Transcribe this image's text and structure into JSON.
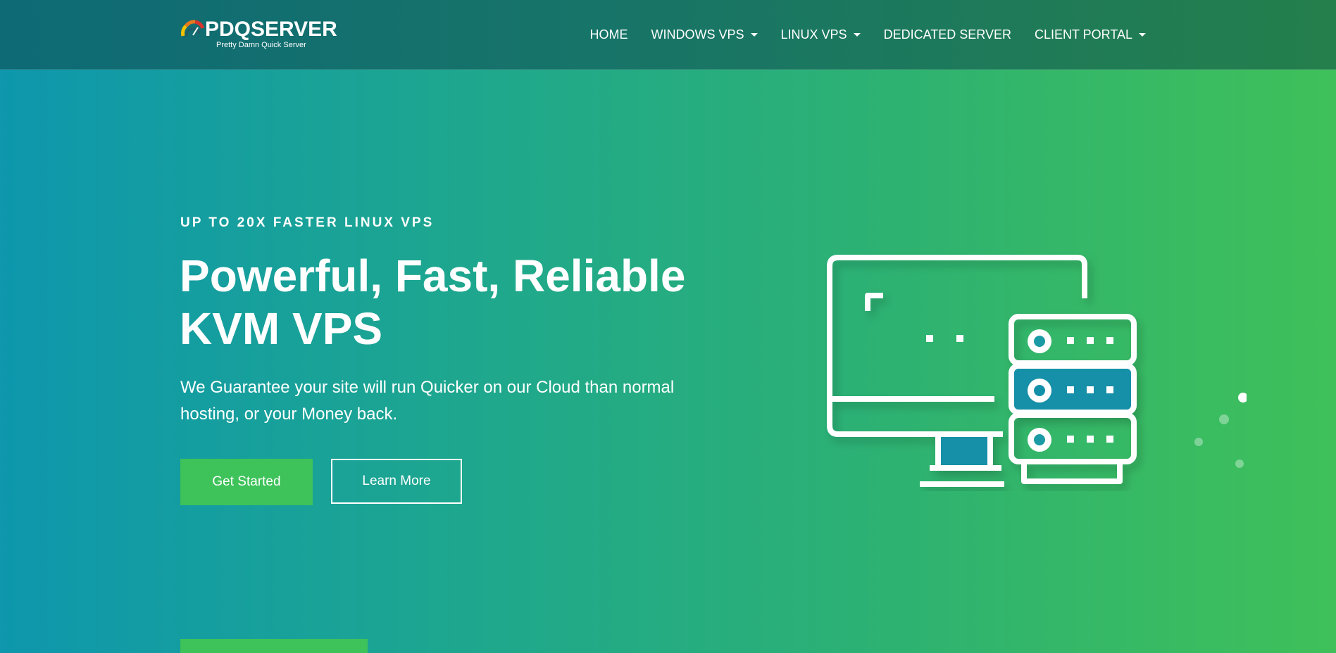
{
  "brand": {
    "name": "PDQSERVER",
    "tagline": "Pretty Damn Quick Server"
  },
  "nav": {
    "home": "HOME",
    "windows_vps": "WINDOWS VPS",
    "linux_vps": "LINUX VPS",
    "dedicated_server": "DEDICATED SERVER",
    "client_portal": "CLIENT PORTAL"
  },
  "hero": {
    "kicker": "UP TO 20X FASTER LINUX VPS",
    "title_line1": "Powerful, Fast, Reliable",
    "title_line2": "KVM VPS",
    "subtitle": "We Guarantee your site will run Quicker on our Cloud than normal hosting, or your Money back.",
    "primary_button": "Get Started",
    "secondary_button": "Learn More"
  },
  "icons": {
    "logo": "speedometer-logo-icon",
    "illustration": "monitor-server-icon",
    "caret": "chevron-down-icon"
  },
  "colors": {
    "accent_green": "#3ec25a",
    "gradient_start": "#0e97ad",
    "gradient_end": "#3fc05a",
    "header_start": "#0e6a75",
    "header_end": "#247f4c"
  }
}
